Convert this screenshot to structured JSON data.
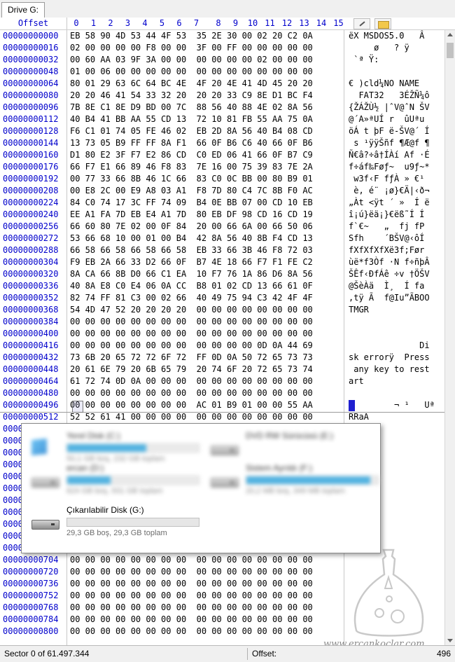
{
  "window": {
    "tab_label": "Drive G:"
  },
  "header": {
    "offset_label": "Offset",
    "columns": [
      "0",
      "1",
      "2",
      "3",
      "4",
      "5",
      "6",
      "7",
      "8",
      "9",
      "10",
      "11",
      "12",
      "13",
      "14",
      "15"
    ]
  },
  "rows": [
    {
      "offset": "00000000000",
      "hex": "EB 58 90 4D 53 44 4F 53  35 2E 30 00 02 20 C2 0A",
      "ascii": "ëX MSDOS5.0   Â"
    },
    {
      "offset": "00000000016",
      "hex": "02 00 00 00 00 F8 00 00  3F 00 FF 00 00 00 00 00",
      "ascii": "     ø   ? ÿ"
    },
    {
      "offset": "00000000032",
      "hex": "00 60 AA 03 9F 3A 00 00  00 00 00 00 02 00 00 00",
      "ascii": " `ª Ÿ:"
    },
    {
      "offset": "00000000048",
      "hex": "01 00 06 00 00 00 00 00  00 00 00 00 00 00 00 00",
      "ascii": ""
    },
    {
      "offset": "00000000064",
      "hex": "80 01 29 63 6C 64 BC 4E  4F 20 4E 41 4D 45 20 20",
      "ascii": "€ )cld¼NO NAME"
    },
    {
      "offset": "00000000080",
      "hex": "20 20 46 41 54 33 32 20  20 20 33 C9 8E D1 BC F4",
      "ascii": "  FAT32   3ÉŽÑ¼ô"
    },
    {
      "offset": "00000000096",
      "hex": "7B 8E C1 8E D9 BD 00 7C  88 56 40 88 4E 02 8A 56",
      "ascii": "{ŽÁŽÙ½ |ˆV@ˆN ŠV"
    },
    {
      "offset": "00000000112",
      "hex": "40 B4 41 BB AA 55 CD 13  72 10 81 FB 55 AA 75 0A",
      "ascii": "@´A»ªUÍ r  ûUªu"
    },
    {
      "offset": "00000000128",
      "hex": "F6 C1 01 74 05 FE 46 02  EB 2D 8A 56 40 B4 08 CD",
      "ascii": "öÁ t þF ë-ŠV@´ Í"
    },
    {
      "offset": "00000000144",
      "hex": "13 73 05 B9 FF FF 8A F1  66 0F B6 C6 40 66 0F B6",
      "ascii": " s ¹ÿÿŠñf ¶Æ@f ¶"
    },
    {
      "offset": "00000000160",
      "hex": "D1 80 E2 3F F7 E2 86 CD  C0 ED 06 41 66 0F B7 C9",
      "ascii": "Ñ€â?÷â†ÍÀí Af ·É"
    },
    {
      "offset": "00000000176",
      "hex": "66 F7 E1 66 89 46 F8 83  7E 16 00 75 39 83 7E 2A",
      "ascii": "f÷áf‰Føƒ~  u9ƒ~*"
    },
    {
      "offset": "00000000192",
      "hex": "00 77 33 66 8B 46 1C 66  83 C0 0C BB 00 80 B9 01",
      "ascii": " w3f‹F fƒÀ » €¹"
    },
    {
      "offset": "00000000208",
      "hex": "00 E8 2C 00 E9 A8 03 A1  F8 7D 80 C4 7C 8B F0 AC",
      "ascii": " è, é¨ ¡ø}€Ä|‹ð¬"
    },
    {
      "offset": "00000000224",
      "hex": "84 C0 74 17 3C FF 74 09  B4 0E BB 07 00 CD 10 EB",
      "ascii": "„Àt <ÿt ´ »  Í ë"
    },
    {
      "offset": "00000000240",
      "hex": "EE A1 FA 7D EB E4 A1 7D  80 EB DF 98 CD 16 CD 19",
      "ascii": "î¡ú}ëä¡}€ëß˜Í Í"
    },
    {
      "offset": "00000000256",
      "hex": "66 60 80 7E 02 00 0F 84  20 00 66 6A 00 66 50 06",
      "ascii": "f`€~   „  fj fP"
    },
    {
      "offset": "00000000272",
      "hex": "53 66 68 10 00 01 00 B4  42 8A 56 40 8B F4 CD 13",
      "ascii": "Sfh    ´BŠV@‹ôÍ"
    },
    {
      "offset": "00000000288",
      "hex": "66 58 66 58 66 58 66 58  EB 33 66 3B 46 F8 72 03",
      "ascii": "fXfXfXfXë3f;Før"
    },
    {
      "offset": "00000000304",
      "hex": "F9 EB 2A 66 33 D2 66 0F  B7 4E 18 66 F7 F1 FE C2",
      "ascii": "ùë*f3Òf ·N f÷ñþÂ"
    },
    {
      "offset": "00000000320",
      "hex": "8A CA 66 8B D0 66 C1 EA  10 F7 76 1A 86 D6 8A 56",
      "ascii": "ŠÊf‹ÐfÁê ÷v †ÖŠV"
    },
    {
      "offset": "00000000336",
      "hex": "40 8A E8 C0 E4 06 0A CC  B8 01 02 CD 13 66 61 0F",
      "ascii": "@ŠèÀä  Ì¸  Í fa"
    },
    {
      "offset": "00000000352",
      "hex": "82 74 FF 81 C3 00 02 66  40 49 75 94 C3 42 4F 4F",
      "ascii": ",tÿ Ã  f@Iu”ÃBOO"
    },
    {
      "offset": "00000000368",
      "hex": "54 4D 47 52 20 20 20 20  00 00 00 00 00 00 00 00",
      "ascii": "TMGR"
    },
    {
      "offset": "00000000384",
      "hex": "00 00 00 00 00 00 00 00  00 00 00 00 00 00 00 00",
      "ascii": ""
    },
    {
      "offset": "00000000400",
      "hex": "00 00 00 00 00 00 00 00  00 00 00 00 00 00 00 00",
      "ascii": ""
    },
    {
      "offset": "00000000416",
      "hex": "00 00 00 00 00 00 00 00  00 00 00 00 0D 0A 44 69",
      "ascii": "              Di"
    },
    {
      "offset": "00000000432",
      "hex": "73 6B 20 65 72 72 6F 72  FF 0D 0A 50 72 65 73 73",
      "ascii": "sk errorÿ  Press"
    },
    {
      "offset": "00000000448",
      "hex": "20 61 6E 79 20 6B 65 79  20 74 6F 20 72 65 73 74",
      "ascii": " any key to rest"
    },
    {
      "offset": "00000000464",
      "hex": "61 72 74 0D 0A 00 00 00  00 00 00 00 00 00 00 00",
      "ascii": "art"
    },
    {
      "offset": "00000000480",
      "hex": "00 00 00 00 00 00 00 00  00 00 00 00 00 00 00 00",
      "ascii": ""
    },
    {
      "offset": "00000000496",
      "hex": "00 00 00 00 00 00 00 00  AC 01 B9 01 00 00 55 AA",
      "ascii": "         ¬ ¹   Uª"
    },
    {
      "offset": "00000000512",
      "hex": "52 52 61 41 00 00 00 00  00 00 00 00 00 00 00 00",
      "ascii": "RRaA"
    },
    {
      "offset": "00000000528",
      "hex": "",
      "ascii": ""
    },
    {
      "offset": "00000000544",
      "hex": "",
      "ascii": ""
    },
    {
      "offset": "00000000560",
      "hex": "",
      "ascii": ""
    },
    {
      "offset": "00000000576",
      "hex": "",
      "ascii": ""
    },
    {
      "offset": "00000000592",
      "hex": "",
      "ascii": ""
    },
    {
      "offset": "00000000608",
      "hex": "",
      "ascii": ""
    },
    {
      "offset": "00000000624",
      "hex": "",
      "ascii": ""
    },
    {
      "offset": "00000000640",
      "hex": "",
      "ascii": ""
    },
    {
      "offset": "00000000656",
      "hex": "",
      "ascii": ""
    },
    {
      "offset": "00000000672",
      "hex": "",
      "ascii": ""
    },
    {
      "offset": "00000000688",
      "hex": "",
      "ascii": ""
    },
    {
      "offset": "00000000704",
      "hex": "00 00 00 00 00 00 00 00  00 00 00 00 00 00 00 00",
      "ascii": ""
    },
    {
      "offset": "00000000720",
      "hex": "00 00 00 00 00 00 00 00  00 00 00 00 00 00 00 00",
      "ascii": ""
    },
    {
      "offset": "00000000736",
      "hex": "00 00 00 00 00 00 00 00  00 00 00 00 00 00 00 00",
      "ascii": ""
    },
    {
      "offset": "00000000752",
      "hex": "00 00 00 00 00 00 00 00  00 00 00 00 00 00 00 00",
      "ascii": ""
    },
    {
      "offset": "00000000768",
      "hex": "00 00 00 00 00 00 00 00  00 00 00 00 00 00 00 00",
      "ascii": ""
    },
    {
      "offset": "00000000784",
      "hex": "00 00 00 00 00 00 00 00  00 00 00 00 00 00 00 00",
      "ascii": ""
    },
    {
      "offset": "00000000800",
      "hex": "00 00 00 00 00 00 00 00  00 00 00 00 00 00 00 00",
      "ascii": ""
    }
  ],
  "drives_popup": {
    "drives": [
      {
        "name": "Yerel Disk (C:)",
        "size": "50,1 GB boş, 232 GB toplam",
        "fill": 0.6,
        "blurred": true,
        "icon": "windows-drive-icon"
      },
      {
        "name": "DVD RW Sürücüsü (E:)",
        "size": "",
        "fill": 0,
        "blurred": true,
        "icon": "dvd-drive-icon"
      },
      {
        "name": "ercan (D:)",
        "size": "624 GB boş, 931 GB toplam",
        "fill": 0.33,
        "blurred": true,
        "icon": "hard-drive-icon"
      },
      {
        "name": "Sistem Ayrıldı (F:)",
        "size": "20,2 MB boş, 349 MB toplam",
        "fill": 0.94,
        "blurred": true,
        "icon": "hard-drive-icon"
      },
      {
        "name": "Çıkarılabilir Disk (G:)",
        "size": "29,3 GB boş, 29,3 GB toplam",
        "fill": 0,
        "blurred": false,
        "icon": "usb-drive-icon"
      }
    ]
  },
  "status": {
    "sector": "Sector 0 of 61.497.344",
    "offset_label": "Offset:",
    "offset_value": "496"
  },
  "watermark": "www.ercankoclar.com",
  "colors": {
    "offset_blue": "#0000cc",
    "progress": "#26a0da",
    "cursor": "#1f1fd0"
  }
}
